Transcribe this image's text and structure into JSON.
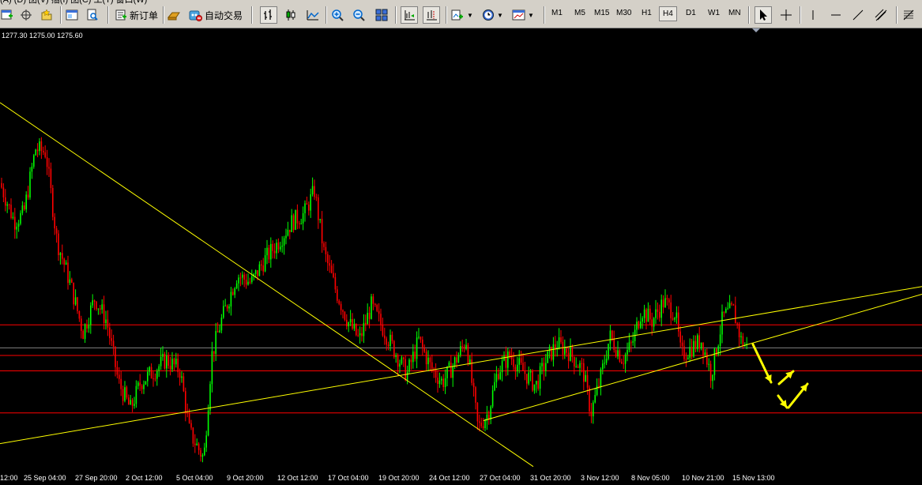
{
  "toolbar": {
    "new_order_label": "新订单",
    "auto_trading_label": "自动交易",
    "menu_fragment": "(A) (D) 图(V) 插(I) 图(C) 工(T) 窗口(W)",
    "timeframes": [
      "M1",
      "M5",
      "M15",
      "M30",
      "H1",
      "H4",
      "D1",
      "W1",
      "MN"
    ],
    "active_timeframe": "H4"
  },
  "ohlc_label": "1277.30 1275.00 1275.60",
  "xaxis": {
    "ticks": [
      "12:00",
      "25 Sep 04:00",
      "27 Sep 20:00",
      "2 Oct 12:00",
      "5 Oct 04:00",
      "9 Oct 20:00",
      "12 Oct 12:00",
      "17 Oct 04:00",
      "19 Oct 20:00",
      "24 Oct 12:00",
      "27 Oct 04:00",
      "31 Oct 20:00",
      "3 Nov 12:00",
      "8 Nov 05:00",
      "10 Nov 21:00",
      "15 Nov 13:00"
    ]
  },
  "colors": {
    "background": "#000000",
    "bull": "#00ff00",
    "bear": "#ff0000",
    "trendline": "#ffff00",
    "level": "#ff0000",
    "bid_line": "#808080",
    "arrows": "#ffff00"
  },
  "chart_data": {
    "type": "candlestick",
    "timeframe": "H4",
    "last_ohlc_shown": [
      1277.3,
      1275.0,
      1275.6
    ],
    "x_tick_labels": [
      "12:00",
      "25 Sep 04:00",
      "27 Sep 20:00",
      "2 Oct 12:00",
      "5 Oct 04:00",
      "9 Oct 20:00",
      "12 Oct 12:00",
      "17 Oct 04:00",
      "19 Oct 20:00",
      "24 Oct 12:00",
      "27 Oct 04:00",
      "31 Oct 20:00",
      "3 Nov 12:00",
      "8 Nov 05:00",
      "10 Nov 21:00",
      "15 Nov 13:00"
    ],
    "price_path": [
      [
        0,
        0.72
      ],
      [
        18,
        0.62
      ],
      [
        30,
        0.64
      ],
      [
        45,
        0.81
      ],
      [
        58,
        0.8
      ],
      [
        72,
        0.57
      ],
      [
        90,
        0.45
      ],
      [
        105,
        0.33
      ],
      [
        120,
        0.42
      ],
      [
        135,
        0.36
      ],
      [
        150,
        0.2
      ],
      [
        165,
        0.13
      ],
      [
        178,
        0.2
      ],
      [
        195,
        0.23
      ],
      [
        210,
        0.26
      ],
      [
        228,
        0.23
      ],
      [
        240,
        0.07
      ],
      [
        258,
        0.0
      ],
      [
        268,
        0.27
      ],
      [
        280,
        0.36
      ],
      [
        300,
        0.48
      ],
      [
        318,
        0.46
      ],
      [
        335,
        0.52
      ],
      [
        350,
        0.56
      ],
      [
        370,
        0.62
      ],
      [
        385,
        0.64
      ],
      [
        398,
        0.7
      ],
      [
        410,
        0.54
      ],
      [
        425,
        0.44
      ],
      [
        440,
        0.36
      ],
      [
        455,
        0.31
      ],
      [
        470,
        0.4
      ],
      [
        485,
        0.34
      ],
      [
        500,
        0.28
      ],
      [
        515,
        0.22
      ],
      [
        530,
        0.31
      ],
      [
        545,
        0.24
      ],
      [
        560,
        0.2
      ],
      [
        575,
        0.25
      ],
      [
        590,
        0.31
      ],
      [
        605,
        0.08
      ],
      [
        618,
        0.12
      ],
      [
        630,
        0.23
      ],
      [
        645,
        0.27
      ],
      [
        662,
        0.23
      ],
      [
        678,
        0.19
      ],
      [
        692,
        0.26
      ],
      [
        705,
        0.3
      ],
      [
        720,
        0.28
      ],
      [
        738,
        0.23
      ],
      [
        748,
        0.12
      ],
      [
        760,
        0.21
      ],
      [
        772,
        0.32
      ],
      [
        788,
        0.26
      ],
      [
        800,
        0.3
      ],
      [
        812,
        0.39
      ],
      [
        825,
        0.36
      ],
      [
        840,
        0.41
      ],
      [
        855,
        0.38
      ],
      [
        862,
        0.27
      ],
      [
        875,
        0.29
      ],
      [
        888,
        0.31
      ],
      [
        900,
        0.22
      ],
      [
        915,
        0.37
      ],
      [
        928,
        0.39
      ],
      [
        938,
        0.31
      ],
      [
        946,
        0.29
      ]
    ],
    "trend_lines": [
      {
        "from": [
          0,
          0.93
        ],
        "to": [
          675,
          -0.02
        ]
      },
      {
        "from": [
          0,
          0.04
        ],
        "to": [
          1167,
          0.45
        ]
      },
      {
        "from": [
          612,
          0.1
        ],
        "to": [
          1167,
          0.43
        ]
      }
    ],
    "horizontal_levels": [
      0.35,
      0.27,
      0.23,
      0.12
    ],
    "bid_level": 0.29,
    "y_scale": "price (unlabeled on screen)"
  }
}
